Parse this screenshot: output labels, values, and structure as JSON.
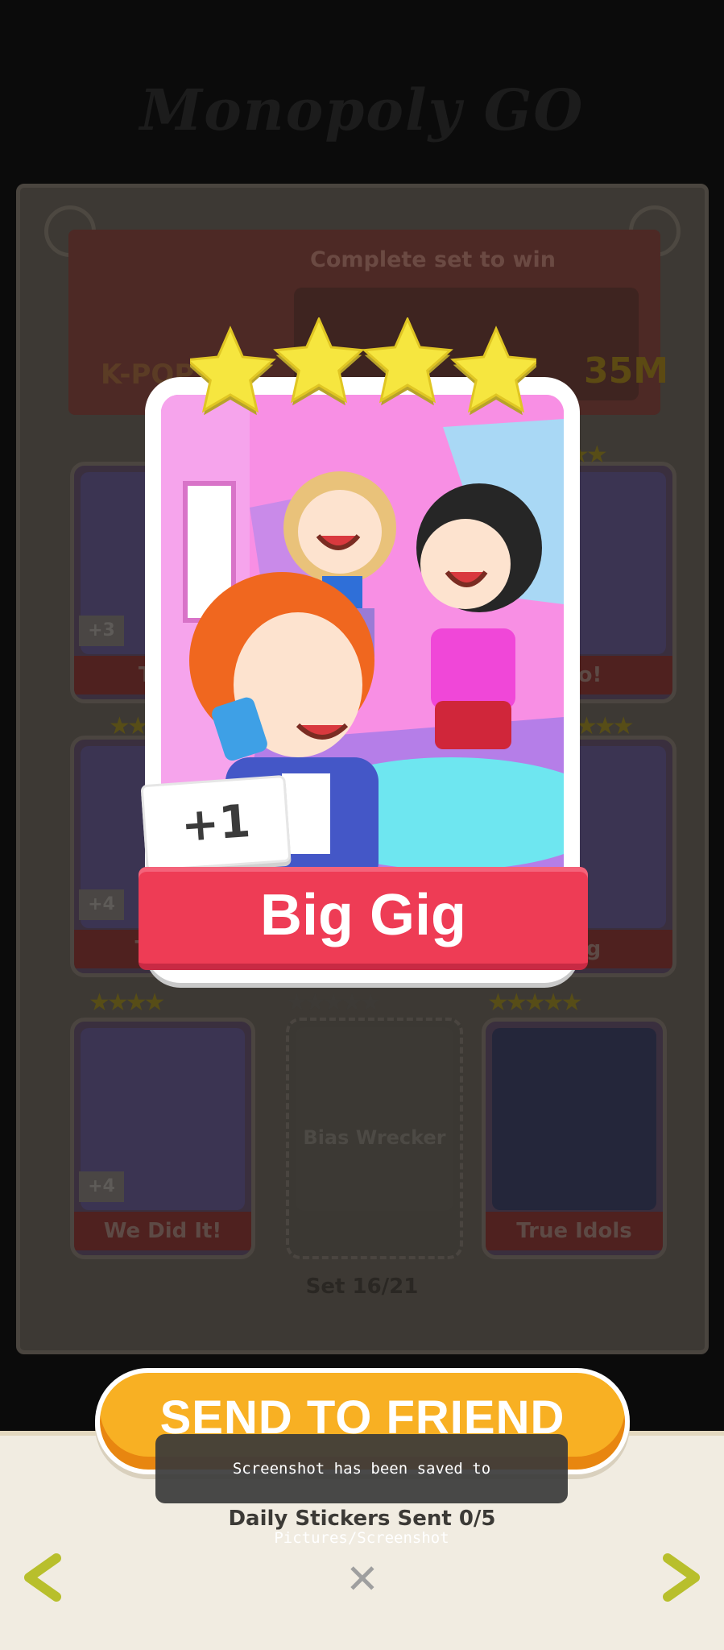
{
  "background": {
    "album_title": "Monopoly GO",
    "set_banner": {
      "set_name": "K-POP",
      "complete_text": "Complete set to win",
      "reward_amount": "35M"
    },
    "cards": [
      {
        "label": "Tra",
        "count": "+3",
        "stars": "★★★"
      },
      {
        "label": "o!",
        "count": "",
        "stars": "★★"
      },
      {
        "label": "The",
        "count": "+4",
        "stars": "★★★"
      },
      {
        "label": "ig",
        "count": "",
        "stars": "★★★"
      },
      {
        "label": "We Did It!",
        "count": "+4",
        "stars": "★★★★"
      },
      {
        "label": "Bias Wrecker",
        "count": "",
        "stars": "★★★★★"
      },
      {
        "label": "True Idols",
        "count": "",
        "stars": "★★★★★"
      }
    ],
    "set_counter": "Set 16/21"
  },
  "sticker": {
    "name": "Big Gig",
    "count_badge": "+1",
    "stars": 4
  },
  "actions": {
    "send_label": "SEND TO FRIEND",
    "daily_sent": "Daily Stickers Sent 0/5",
    "close_glyph": "✕",
    "prev_icon": "chevron-left-icon",
    "next_icon": "chevron-right-icon"
  },
  "toast": {
    "message": "Screenshot has been saved to  Pictures/Screenshot"
  },
  "colors": {
    "ribbon": "#ee3c55",
    "send_button": "#f8b023",
    "arrow": "#b8bf2c",
    "star": "#f6e63f"
  }
}
